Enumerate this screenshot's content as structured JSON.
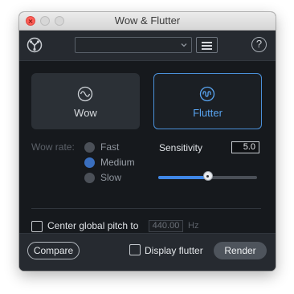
{
  "window": {
    "title": "Wow & Flutter",
    "traffic_lights": [
      "close",
      "minimize",
      "zoom"
    ]
  },
  "header": {
    "logo_icon": "izotope-rx-logo-icon",
    "preset_value": "",
    "menu_icon": "hamburger-menu-icon",
    "help_label": "?"
  },
  "modes": {
    "wow": {
      "label": "Wow",
      "icon": "wave-circle-icon",
      "selected": false
    },
    "flutter": {
      "label": "Flutter",
      "icon": "ripple-circle-icon",
      "selected": true
    }
  },
  "wow_rate": {
    "label": "Wow rate:",
    "options": [
      {
        "label": "Fast",
        "selected": false
      },
      {
        "label": "Medium",
        "selected": true
      },
      {
        "label": "Slow",
        "selected": false
      }
    ],
    "enabled": false
  },
  "sensitivity": {
    "label": "Sensitivity",
    "value": "5.0",
    "fraction": 0.5
  },
  "center_pitch": {
    "label": "Center global pitch to",
    "checked": false,
    "value": "440.00",
    "unit": "Hz"
  },
  "footer": {
    "compare_label": "Compare",
    "display_flutter_label": "Display flutter",
    "display_flutter_checked": false,
    "render_label": "Render"
  },
  "colors": {
    "accent": "#4a90d9",
    "slider_fill": "#3f87e6",
    "panel_bg": "#16191d",
    "bar_bg": "#262a30"
  }
}
